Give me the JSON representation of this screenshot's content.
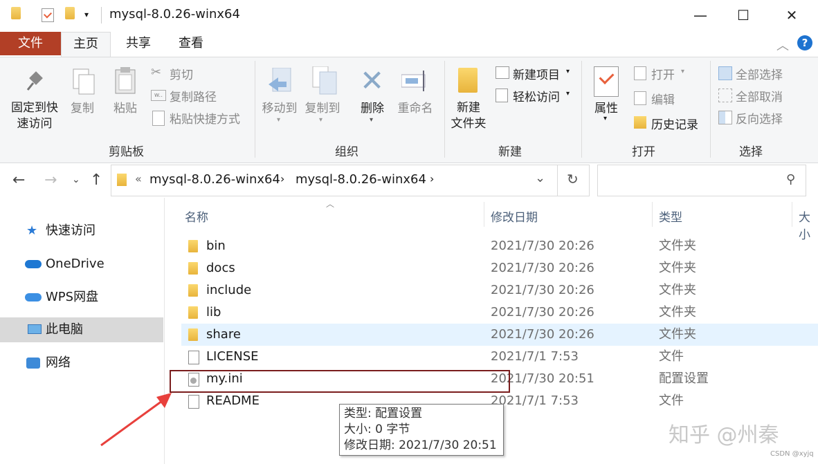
{
  "window": {
    "title": "mysql-8.0.26-winx64"
  },
  "ribbon_tabs": {
    "file": "文件",
    "home": "主页",
    "share": "共享",
    "view": "查看"
  },
  "clipboard": {
    "pin": "固定到快\n速访问",
    "copy": "复制",
    "paste": "粘贴",
    "cut": "剪切",
    "copy_path": "复制路径",
    "paste_shortcut": "粘贴快捷方式",
    "label": "剪贴板"
  },
  "organize": {
    "move_to": "移动到",
    "copy_to": "复制到",
    "delete": "删除",
    "rename": "重命名",
    "label": "组织"
  },
  "new": {
    "new_item": "新建项目",
    "easy_access": "轻松访问",
    "new_folder": "新建\n文件夹",
    "label": "新建"
  },
  "open": {
    "properties": "属性",
    "open": "打开",
    "edit": "编辑",
    "history": "历史记录",
    "label": "打开"
  },
  "select": {
    "select_all": "全部选择",
    "select_none": "全部取消",
    "invert": "反向选择",
    "label": "选择"
  },
  "address": {
    "overflow": "«",
    "crumb1": "mysql-8.0.26-winx64",
    "crumb2": "mysql-8.0.26-winx64"
  },
  "nav": {
    "quick": "快速访问",
    "onedrive": "OneDrive",
    "wps": "WPS网盘",
    "pc": "此电脑",
    "network": "网络"
  },
  "columns": {
    "name": "名称",
    "date": "修改日期",
    "type": "类型",
    "size": "大小"
  },
  "files": [
    {
      "name": "bin",
      "date": "2021/7/30 20:26",
      "type": "文件夹",
      "kind": "folder"
    },
    {
      "name": "docs",
      "date": "2021/7/30 20:26",
      "type": "文件夹",
      "kind": "folder"
    },
    {
      "name": "include",
      "date": "2021/7/30 20:26",
      "type": "文件夹",
      "kind": "folder"
    },
    {
      "name": "lib",
      "date": "2021/7/30 20:26",
      "type": "文件夹",
      "kind": "folder"
    },
    {
      "name": "share",
      "date": "2021/7/30 20:26",
      "type": "文件夹",
      "kind": "folder"
    },
    {
      "name": "LICENSE",
      "date": "2021/7/1 7:53",
      "type": "文件",
      "kind": "file"
    },
    {
      "name": "my.ini",
      "date": "2021/7/30 20:51",
      "type": "配置设置",
      "kind": "ini"
    },
    {
      "name": "README",
      "date": "2021/7/1 7:53",
      "type": "文件",
      "kind": "file"
    }
  ],
  "tooltip": {
    "line1": "类型: 配置设置",
    "line2": "大小: 0 字节",
    "line3": "修改日期: 2021/7/30 20:51"
  },
  "watermark": "知乎 @州秦",
  "csdn_mark": "CSDN @xyjq",
  "colors": {
    "file_tab": "#b23f26",
    "hover_row": "#e5f3ff",
    "selected_nav": "#d9d9d9",
    "annotation": "#e8403c"
  }
}
